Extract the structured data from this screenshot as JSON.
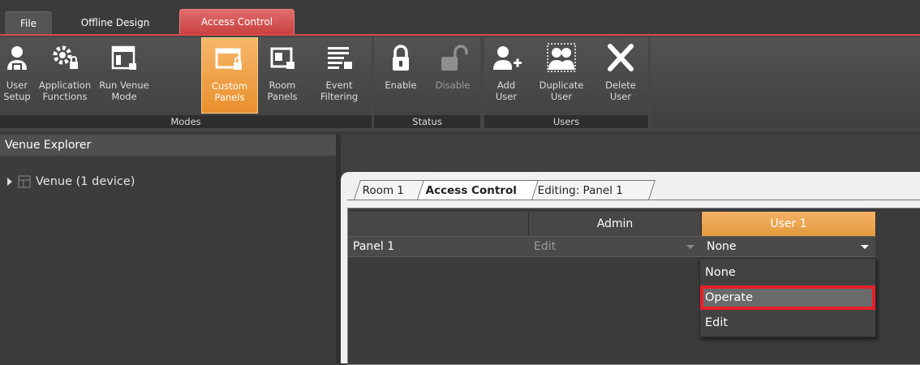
{
  "tabs": {
    "file": "File",
    "offline_design": "Offline Design",
    "access_control": "Access Control"
  },
  "ribbon": {
    "modes": {
      "label": "Modes",
      "user_setup": "User\nSetup",
      "application_functions": "Application\nFunctions",
      "run_venue_mode": "Run Venue\nMode",
      "custom_panels": "Custom\nPanels",
      "room_panels": "Room\nPanels",
      "event_filtering": "Event\nFiltering"
    },
    "status": {
      "label": "Status",
      "enable": "Enable",
      "disable": "Disable"
    },
    "users": {
      "label": "Users",
      "add_user": "Add\nUser",
      "duplicate_user": "Duplicate\nUser",
      "delete_user": "Delete\nUser"
    }
  },
  "explorer": {
    "title": "Venue Explorer",
    "tree_item": "Venue (1 device)"
  },
  "subtabs": [
    "Room 1",
    "Access Control",
    "Editing: Panel 1"
  ],
  "grid": {
    "columns": [
      "",
      "Admin",
      "User 1"
    ],
    "row": {
      "name": "Panel 1",
      "admin": "Edit",
      "user1": "None"
    }
  },
  "dropdown": {
    "options": [
      "None",
      "Operate",
      "Edit"
    ],
    "highlighted": "Operate"
  },
  "colors": {
    "accent_red": "#d94a4a",
    "active_orange": "#e9902d",
    "highlight_box": "#e8202a"
  }
}
